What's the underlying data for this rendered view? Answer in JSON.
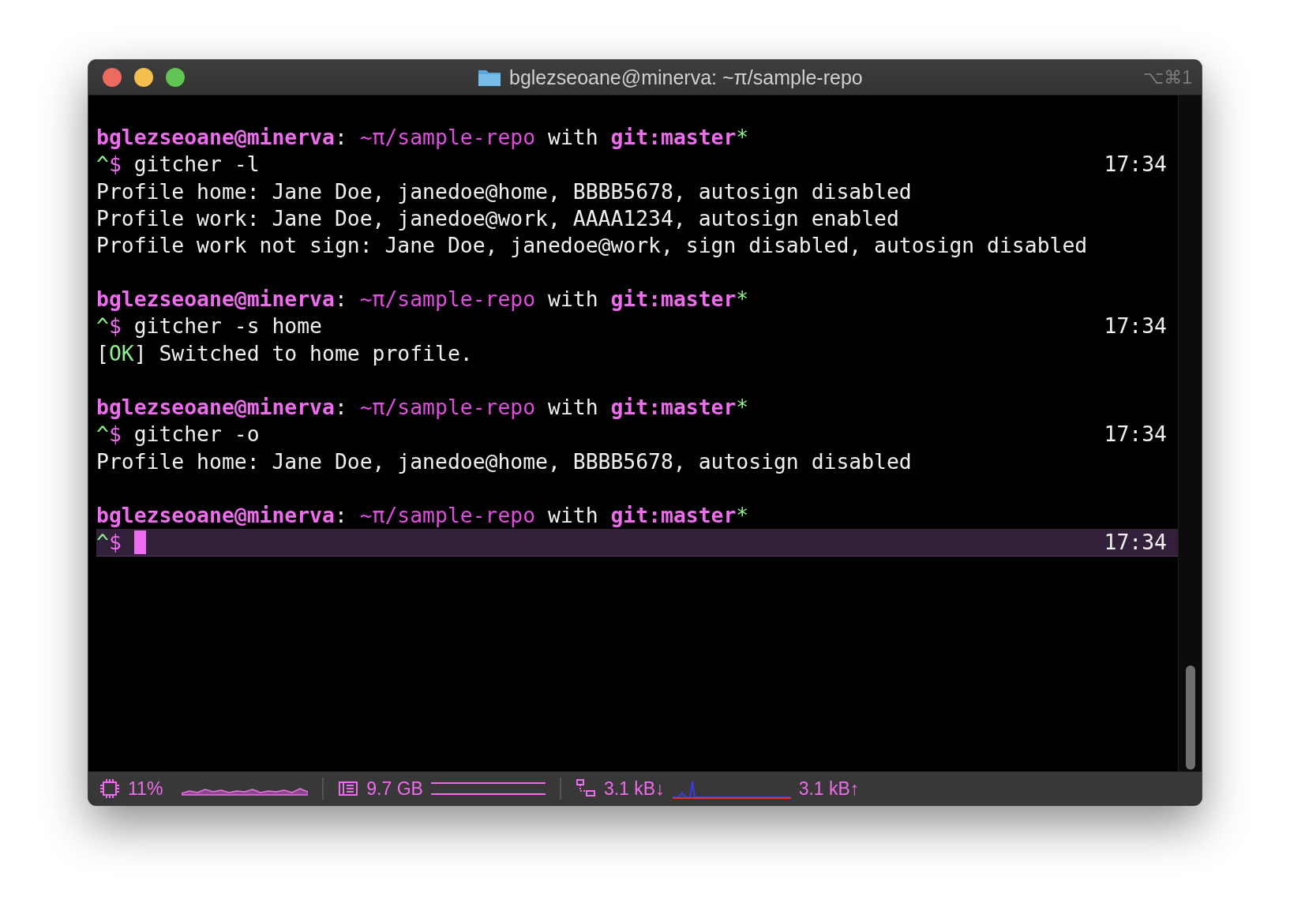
{
  "window": {
    "title": "bglezseoane@minerva: ~π/sample-repo",
    "shortcut": "⌥⌘1"
  },
  "blocks": [
    {
      "prompt": {
        "user_host": "bglezseoane@minerva",
        "separator": ":",
        "path": "~π/sample-repo",
        "with": "with",
        "branch": "git:master",
        "dirty": "*"
      },
      "caret": "^",
      "dollar": "$",
      "command": "gitcher -l",
      "time": "17:34",
      "active": false,
      "output": [
        [
          {
            "kind": "plain",
            "text": "Profile home: Jane Doe, janedoe@home, BBBB5678, autosign disabled"
          }
        ],
        [
          {
            "kind": "plain",
            "text": "Profile work: Jane Doe, janedoe@work, AAAA1234, autosign enabled"
          }
        ],
        [
          {
            "kind": "plain",
            "text": "Profile work not sign: Jane Doe, janedoe@work, sign disabled, autosign disabled"
          }
        ]
      ]
    },
    {
      "prompt": {
        "user_host": "bglezseoane@minerva",
        "separator": ":",
        "path": "~π/sample-repo",
        "with": "with",
        "branch": "git:master",
        "dirty": "*"
      },
      "caret": "^",
      "dollar": "$",
      "command": "gitcher -s home",
      "time": "17:34",
      "active": false,
      "output": [
        [
          {
            "kind": "plain",
            "text": "["
          },
          {
            "kind": "ok",
            "text": "OK"
          },
          {
            "kind": "plain",
            "text": "] Switched to home profile."
          }
        ]
      ]
    },
    {
      "prompt": {
        "user_host": "bglezseoane@minerva",
        "separator": ":",
        "path": "~π/sample-repo",
        "with": "with",
        "branch": "git:master",
        "dirty": "*"
      },
      "caret": "^",
      "dollar": "$",
      "command": "gitcher -o",
      "time": "17:34",
      "active": false,
      "output": [
        [
          {
            "kind": "plain",
            "text": "Profile home: Jane Doe, janedoe@home, BBBB5678, autosign disabled"
          }
        ]
      ]
    },
    {
      "prompt": {
        "user_host": "bglezseoane@minerva",
        "separator": ":",
        "path": "~π/sample-repo",
        "with": "with",
        "branch": "git:master",
        "dirty": "*"
      },
      "caret": "^",
      "dollar": "$",
      "time": "17:34",
      "active": true
    }
  ],
  "status_bar": {
    "cpu": "11%",
    "memory": "9.7 GB",
    "download": "3.1 kB↓",
    "upload": "3.1 kB↑"
  }
}
